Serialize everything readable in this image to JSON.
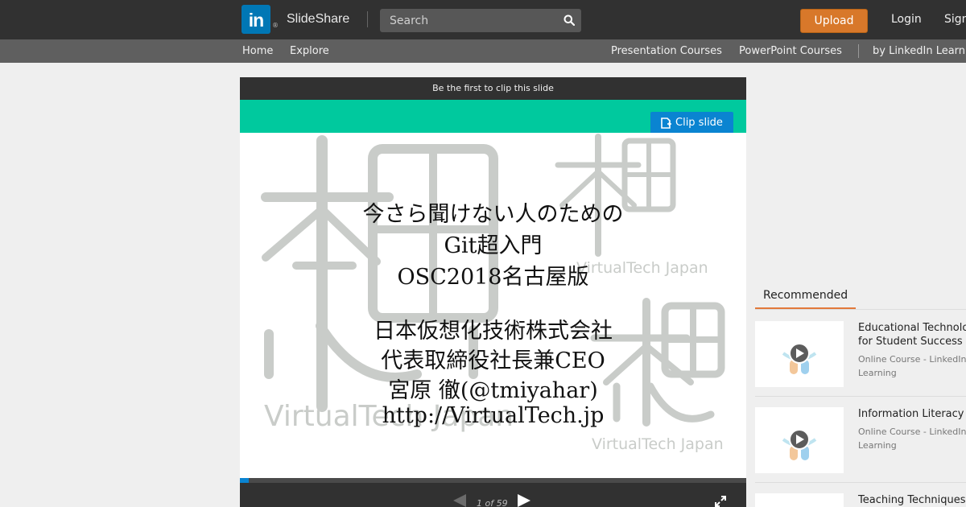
{
  "brand": {
    "logo_letters": "in",
    "registered_mark": "®",
    "name": "SlideShare"
  },
  "header": {
    "search_placeholder": "Search",
    "upload_label": "Upload",
    "login_label": "Login",
    "signup_label": "Signup"
  },
  "subnav": {
    "home": "Home",
    "explore": "Explore",
    "presentation_courses": "Presentation Courses",
    "powerpoint_courses": "PowerPoint Courses",
    "by_linkedin_learning": "by LinkedIn Learning"
  },
  "player": {
    "clip_banner": "Be the first to clip this slide",
    "clip_button": "Clip slide",
    "current_page": 1,
    "total_pages": 59,
    "page_counter": "1 of 59",
    "progress_fraction": 0.017
  },
  "slide": {
    "lines": [
      "今さら聞けない人のための",
      "Git超入門",
      "OSC2018名古屋版",
      "日本仮想化技術株式会社",
      "代表取締役社長兼CEO",
      "宮原 徹(@tmiyahar)",
      "http://VirtualTech.jp"
    ],
    "watermark_text": "VirtualTech Japan"
  },
  "sidebar": {
    "recommended_tab": "Recommended",
    "items": [
      {
        "title": "Educational Technology for Student Success",
        "title_line1": "Educational Technology",
        "title_line2": "for Student Success",
        "sub_line1": "Online Course - LinkedIn",
        "sub_line2": "Learning"
      },
      {
        "title": "Information Literacy",
        "sub_line1": "Online Course - LinkedIn",
        "sub_line2": "Learning"
      },
      {
        "title": "Teaching Techniques"
      }
    ]
  },
  "colors": {
    "topbar": "#313131",
    "subnav": "#5f5f5f",
    "upload": "#d8782a",
    "clip_strip": "#00c99e",
    "clip_button": "#0a84d1",
    "linkedin_blue": "#0077b5",
    "recommended_accent": "#e2793a"
  }
}
